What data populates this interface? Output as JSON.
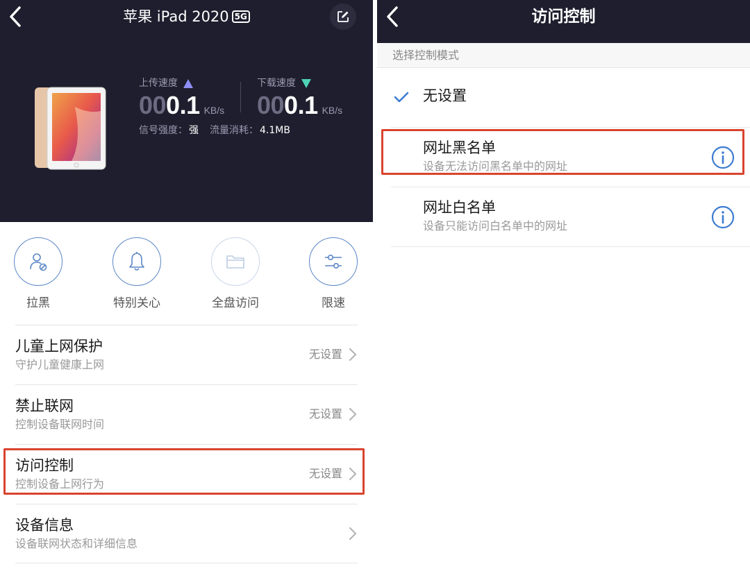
{
  "left": {
    "title": "苹果 iPad 2020",
    "title_badge": "5G",
    "upload": {
      "label": "上传速度",
      "digits_dim": "00",
      "digits_bright": "0.1",
      "unit": "KB/s"
    },
    "download": {
      "label": "下载速度",
      "digits_dim": "00",
      "digits_bright": "0.1",
      "unit": "KB/s"
    },
    "signal_label": "信号强度：",
    "signal_value": "强",
    "traffic_label": "流量消耗：",
    "traffic_value": "4.1MB",
    "actions": [
      {
        "label": "拉黑",
        "icon": "block-user-icon"
      },
      {
        "label": "特别关心",
        "icon": "bell-icon"
      },
      {
        "label": "全盘访问",
        "icon": "folder-icon"
      },
      {
        "label": "限速",
        "icon": "sliders-icon"
      }
    ],
    "menu": [
      {
        "title": "儿童上网保护",
        "subtitle": "守护儿童健康上网",
        "value": "无设置"
      },
      {
        "title": "禁止联网",
        "subtitle": "控制设备联网时间",
        "value": "无设置"
      },
      {
        "title": "访问控制",
        "subtitle": "控制设备上网行为",
        "value": "无设置"
      },
      {
        "title": "设备信息",
        "subtitle": "设备联网状态和详细信息",
        "value": ""
      }
    ]
  },
  "right": {
    "title": "访问控制",
    "section_header": "选择控制模式",
    "options": [
      {
        "title": "无设置",
        "subtitle": "",
        "selected": true
      },
      {
        "title": "网址黑名单",
        "subtitle": "设备无法访问黑名单中的网址",
        "selected": false
      },
      {
        "title": "网址白名单",
        "subtitle": "设备只能访问白名单中的网址",
        "selected": false
      }
    ]
  },
  "colors": {
    "header_bg": "#1e1e2e",
    "accent_blue": "#3d7bd1",
    "highlight_red": "#d9432f",
    "upload_arrow": "#8e8ef5",
    "download_arrow": "#4ed3b5"
  }
}
